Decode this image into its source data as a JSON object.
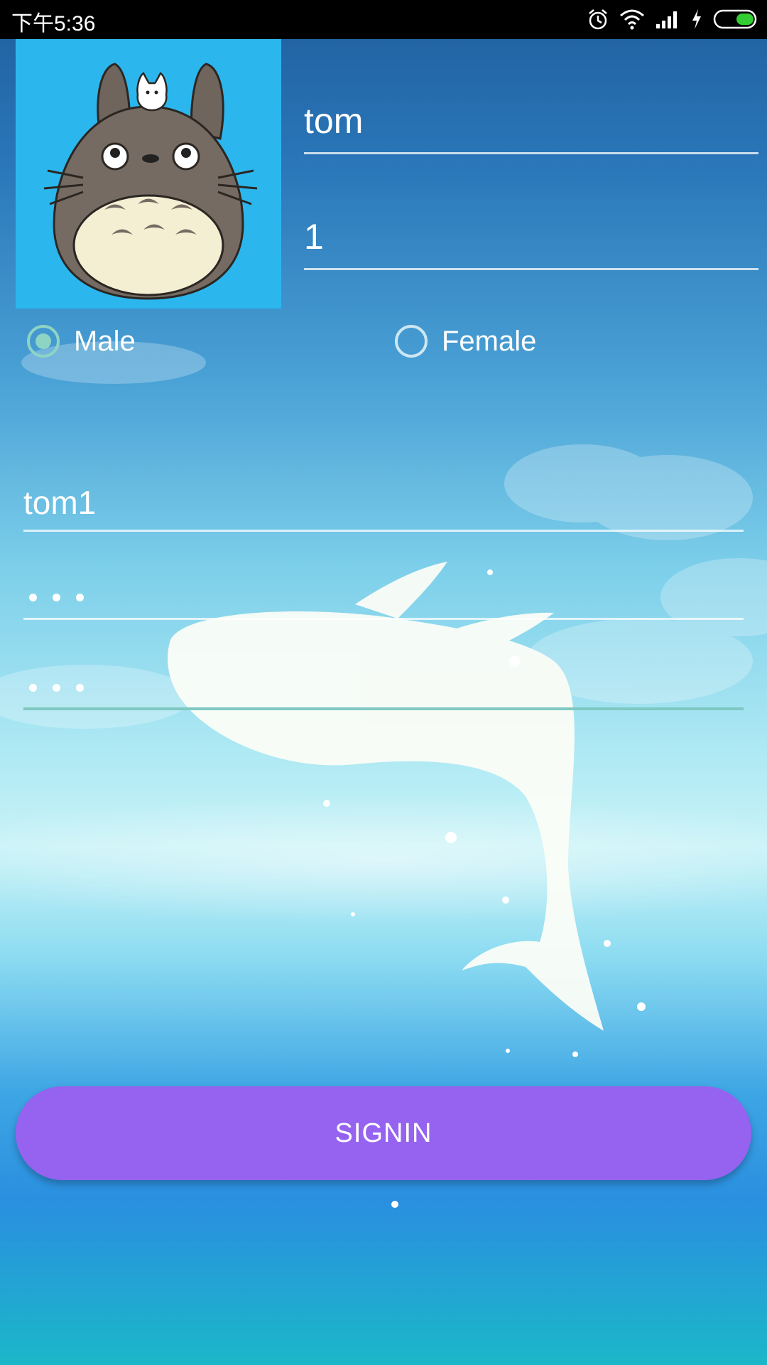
{
  "status_bar": {
    "time": "下午5:36",
    "icons": [
      "alarm-icon",
      "wifi-icon",
      "signal-icon",
      "charging-icon",
      "battery-icon"
    ],
    "battery_color": "#33cc33"
  },
  "form": {
    "name_value": "tom",
    "age_value": "1",
    "gender_options": [
      {
        "label": "Male",
        "checked": true
      },
      {
        "label": "Female",
        "checked": false
      }
    ],
    "username_value": "tom1",
    "password_mask": "•••",
    "confirm_password_mask": "•••"
  },
  "signin_button": {
    "label": "SIGNIN",
    "color": "#9563f0"
  },
  "colors": {
    "avatar_background": "#2bb7ee",
    "radio_accent": "#8ed4c4"
  }
}
